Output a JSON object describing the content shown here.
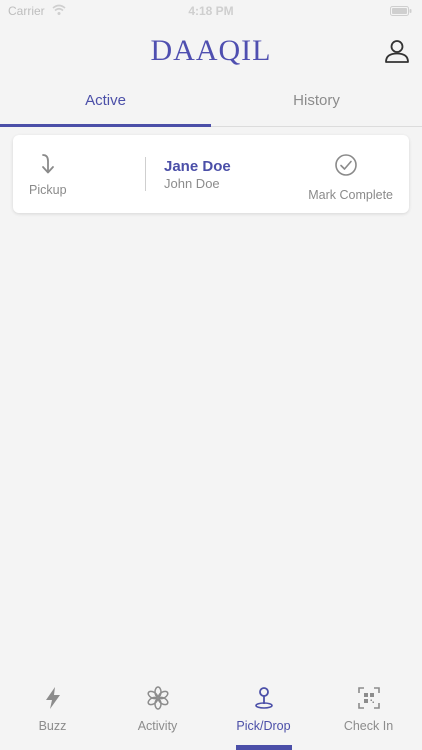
{
  "status_bar": {
    "carrier": "Carrier",
    "time": "4:18 PM"
  },
  "header": {
    "title": "DAAQIL",
    "profile_icon": "person-icon"
  },
  "tabs": [
    {
      "label": "Active",
      "selected": true
    },
    {
      "label": "History",
      "selected": false
    }
  ],
  "card": {
    "pickup_label": "Pickup",
    "pickup_icon": "arrow-turn-down-icon",
    "name": "Jane Doe",
    "subname": "John Doe",
    "complete_label": "Mark Complete",
    "complete_icon": "check-circle-icon"
  },
  "bottom_nav": [
    {
      "label": "Buzz",
      "icon": "lightning-icon",
      "selected": false
    },
    {
      "label": "Activity",
      "icon": "asterisk-flower-icon",
      "selected": false
    },
    {
      "label": "Pick/Drop",
      "icon": "location-pin-icon",
      "selected": true
    },
    {
      "label": "Check In",
      "icon": "qr-scan-icon",
      "selected": false
    }
  ],
  "colors": {
    "accent": "#4b4fa8",
    "background": "#f4f4f4",
    "card": "#ffffff",
    "muted_text": "#8c8c8c"
  }
}
